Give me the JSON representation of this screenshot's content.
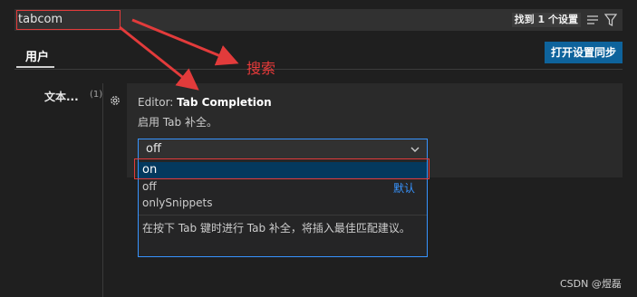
{
  "search": {
    "value": "tabcom",
    "result_count": "找到 1 个设置"
  },
  "tabs": {
    "user": "用户"
  },
  "sync_button": "打开设置同步",
  "toc": {
    "item": "文本...",
    "count": "(1)"
  },
  "setting": {
    "title_prefix": "Editor: ",
    "title_name": "Tab Completion",
    "description": "启用 Tab 补全。",
    "selected_value": "off",
    "options": [
      {
        "label": "on"
      },
      {
        "label": "off",
        "badge": "默认"
      },
      {
        "label": "onlySnippets"
      }
    ],
    "option_description": "在按下 Tab 键时进行 Tab 补全，将插入最佳匹配建议。"
  },
  "annotation": "搜索",
  "watermark": "CSDN @煜磊",
  "colors": {
    "accent": "#3794ff",
    "annotation": "#e23b3b",
    "button": "#0e639c",
    "selection": "#04395e"
  }
}
